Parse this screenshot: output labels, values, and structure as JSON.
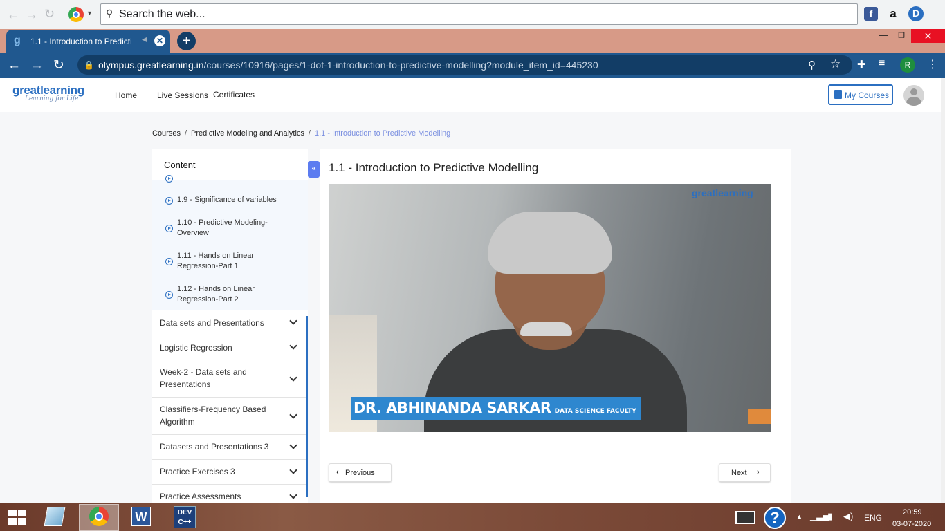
{
  "browser": {
    "top_search_placeholder": "Search the web...",
    "tab_title": "1.1 - Introduction to Predicti",
    "new_tab_symbol": "+",
    "url_domain": "olympus.greatlearning.in",
    "url_path": "/courses/10916/pages/1-dot-1-introduction-to-predictive-modelling?module_item_id=445230",
    "profile_initial": "R",
    "extension_d": "D",
    "extension_a": "a",
    "extension_f": "f"
  },
  "site": {
    "logo": "greatlearning",
    "logo_tagline": "Learning for Life",
    "nav": [
      "Home",
      "Live Sessions",
      "Certificates"
    ],
    "my_courses": "My Courses"
  },
  "breadcrumb": {
    "items": [
      "Courses",
      "Predictive Modeling and Analytics"
    ],
    "current": "1.1 - Introduction to Predictive Modelling",
    "separator": "/"
  },
  "sidebar": {
    "heading": "Content",
    "collapse_symbol": "«",
    "sub_items": [
      "1.9 - Significance of variables",
      "1.10 - Predictive Modeling-Overview",
      "1.11 - Hands on Linear Regression-Part 1",
      "1.12 - Hands on Linear Regression-Part 2"
    ],
    "modules": [
      "Data sets and Presentations",
      "Logistic Regression",
      "Week-2 - Data sets and Presentations",
      "Classifiers-Frequency Based Algorithm",
      "Datasets and Presentations 3",
      "Practice Exercises 3",
      "Practice Assessments"
    ]
  },
  "main": {
    "title": "1.1 - Introduction to Predictive Modelling",
    "video_logo": "greatlearning",
    "video_logo_tagline": "Learning for Life",
    "speaker_name": "DR. ABHINANDA SARKAR",
    "speaker_role": "DATA SCIENCE FACULTY",
    "prev_label": "Previous",
    "next_label": "Next"
  },
  "taskbar": {
    "language": "ENG",
    "time": "20:59",
    "date": "03-07-2020",
    "devcpp_label": "DEV C++",
    "word_label": "W"
  },
  "colors": {
    "browser_chrome": "#20588f",
    "tab_strip": "#d79a87",
    "brand_blue": "#2b6fc1",
    "breadcrumb_current": "#7a8fe0",
    "collapse_button": "#5c7cf0"
  }
}
